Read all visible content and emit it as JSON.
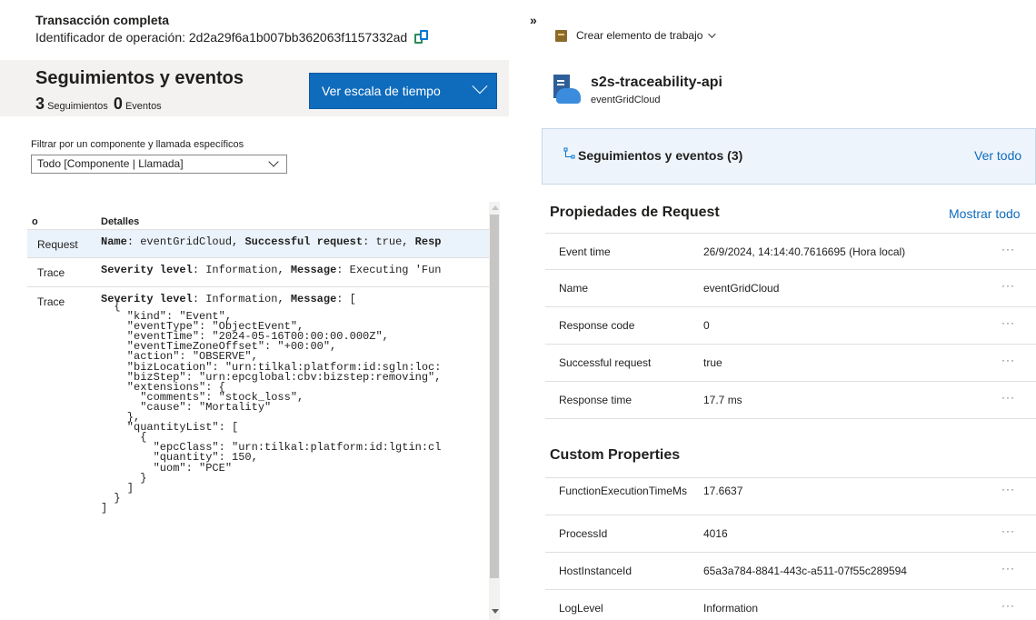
{
  "transaction": {
    "title": "Transacción completa",
    "operation_label": "Identificador de operación: 2d2a29f6a1b007bb362063f1157332ad"
  },
  "traces": {
    "title": "Seguimientos y eventos",
    "trace_count": "3",
    "trace_label": "Seguimientos",
    "event_count": "0",
    "event_label": "Eventos",
    "timeline_button": "Ver escala de tiempo"
  },
  "filter": {
    "label": "Filtrar por un componente y llamada específicos",
    "selected": "Todo [Componente | Llamada]"
  },
  "grid": {
    "col_type": "o",
    "col_details": "Detalles",
    "rows": [
      {
        "type": "Request",
        "k1": "Name",
        "v1": ": eventGridCloud, ",
        "k2": "Successful request",
        "v2": ": true, ",
        "k3": "Resp"
      },
      {
        "type": "Trace",
        "k1": "Severity level",
        "v1": ": Information, ",
        "k2": "Message",
        "v2": ": Executing 'Fun",
        "k3": ""
      },
      {
        "type": "Trace",
        "k1": "Severity level",
        "v1": ": Information, ",
        "k2": "Message",
        "v2": ": [",
        "k3": ""
      }
    ],
    "json_lines": [
      "  {",
      "    \"kind\": \"Event\",",
      "    \"eventType\": \"ObjectEvent\",",
      "    \"eventTime\": \"2024-05-16T00:00:00.000Z\",",
      "    \"eventTimeZoneOffset\": \"+00:00\",",
      "    \"action\": \"OBSERVE\",",
      "    \"bizLocation\": \"urn:tilkal:platform:id:sgln:loc:",
      "    \"bizStep\": \"urn:epcglobal:cbv:bizstep:removing\",",
      "    \"extensions\": {",
      "      \"comments\": \"stock_loss\",",
      "      \"cause\": \"Mortality\"",
      "    },",
      "    \"quantityList\": [",
      "      {",
      "        \"epcClass\": \"urn:tilkal:platform:id:lgtin:cl",
      "        \"quantity\": 150,",
      "        \"uom\": \"PCE\"",
      "      }",
      "    ]",
      "  }",
      "]"
    ]
  },
  "collapse": "»",
  "right": {
    "work_item": "Crear elemento de trabajo",
    "app_name": "s2s-traceability-api",
    "app_sub": "eventGridCloud",
    "traces_box_icon": "trace-icon",
    "traces_box_title": "Seguimientos y eventos (3)",
    "traces_box_link": "Ver todo",
    "props_title": "Propiedades de Request",
    "show_all": "Mostrar todo",
    "props": [
      {
        "k": "Event time",
        "v": "26/9/2024, 14:14:40.7616695 (Hora local)"
      },
      {
        "k": "Name",
        "v": "eventGridCloud"
      },
      {
        "k": "Response code",
        "v": "0"
      },
      {
        "k": "Successful request",
        "v": "true"
      },
      {
        "k": "Response time",
        "v": "17.7 ms"
      }
    ],
    "custom_title": "Custom Properties",
    "custom": [
      {
        "k": "FunctionExecutionTimeMs",
        "v": "17.6637"
      },
      {
        "k": "ProcessId",
        "v": "4016"
      },
      {
        "k": "HostInstanceId",
        "v": "65a3a784-8841-443c-a511-07f55c289594"
      },
      {
        "k": "LogLevel",
        "v": "Information"
      }
    ],
    "more": "···"
  },
  "colors": {
    "accent": "#0f6cbd",
    "band": "#f3f2f1",
    "selected_row": "#eaf2fb"
  }
}
